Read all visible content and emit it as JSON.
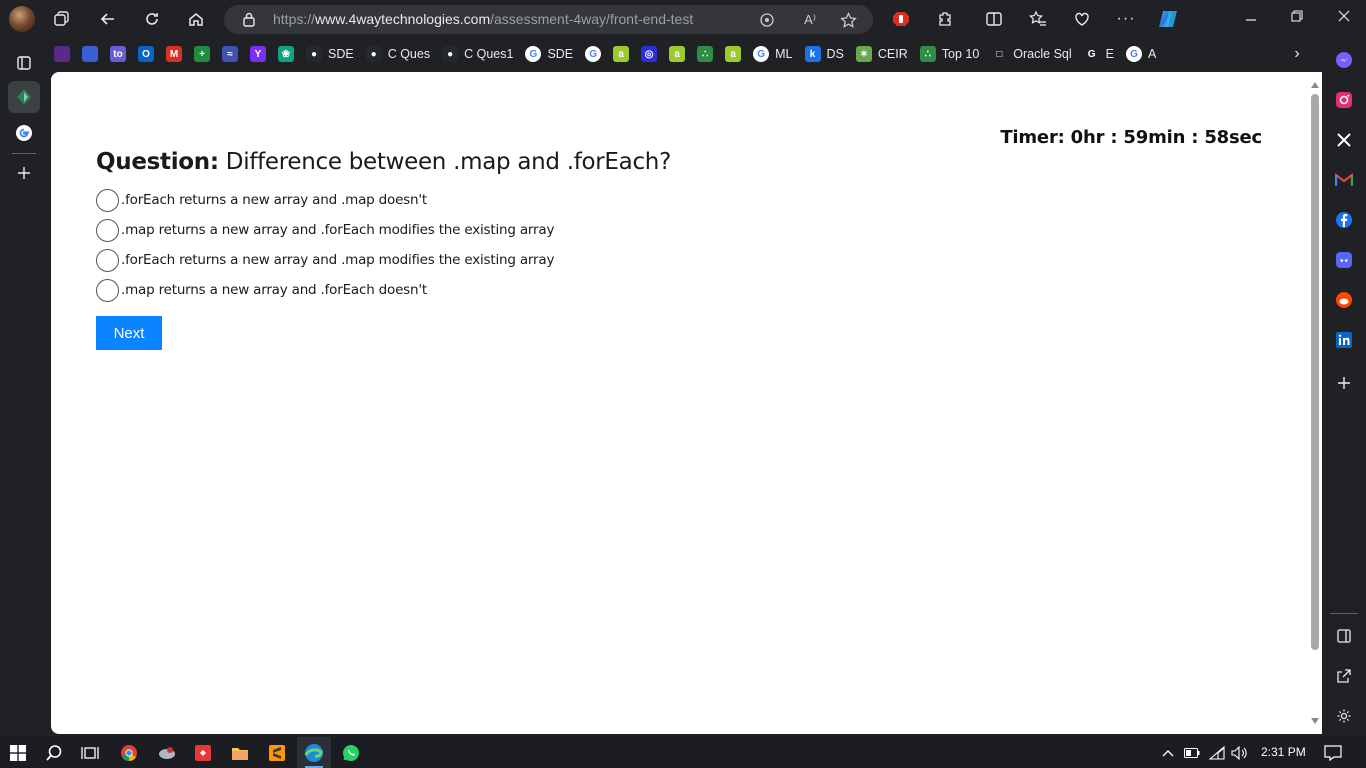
{
  "browser": {
    "url_prefix": "https://",
    "url_domain": "www.4waytechnologies.com",
    "url_path": "/assessment-4way/front-end-test",
    "read_aloud_label": "A⁾",
    "more_label": "···"
  },
  "bookmarks": [
    {
      "label": "",
      "icon": "purple-app-icon",
      "color": "#5b2a86"
    },
    {
      "label": "",
      "icon": "blue-circle-icon",
      "color": "#3a5ed8"
    },
    {
      "label": "",
      "icon": "to-icon",
      "color": "#6a5cd6",
      "glyph": "to"
    },
    {
      "label": "",
      "icon": "outlook-icon",
      "color": "#0a64c8",
      "glyph": "O"
    },
    {
      "label": "",
      "icon": "gmail-icon",
      "color": "#d93025",
      "glyph": "M"
    },
    {
      "label": "",
      "icon": "green-plus-icon",
      "color": "#1e8e3e",
      "glyph": "+"
    },
    {
      "label": "",
      "icon": "blue-waves-icon",
      "color": "#3f51b5",
      "glyph": "≈"
    },
    {
      "label": "",
      "icon": "purple-y-icon",
      "color": "#7b2ff7",
      "glyph": "Y"
    },
    {
      "label": "",
      "icon": "chatgpt-icon",
      "color": "#10a37f",
      "glyph": "❀"
    },
    {
      "label": "SDE",
      "icon": "github-icon",
      "color": "#24292e",
      "glyph": "●"
    },
    {
      "label": "C Ques",
      "icon": "github-icon",
      "color": "#24292e",
      "glyph": "●"
    },
    {
      "label": "C Ques1",
      "icon": "github-icon",
      "color": "#24292e",
      "glyph": "●"
    },
    {
      "label": "SDE",
      "icon": "google-icon",
      "color": "#ffffff",
      "glyph": "G"
    },
    {
      "label": "",
      "icon": "google-icon",
      "color": "#ffffff",
      "glyph": "G"
    },
    {
      "label": "",
      "icon": "yellow-a-icon",
      "color": "#9ccc2c",
      "glyph": "a"
    },
    {
      "label": "",
      "icon": "blue-ring-icon",
      "color": "#2b2fd6",
      "glyph": "◎"
    },
    {
      "label": "",
      "icon": "yellow-a-icon",
      "color": "#9ccc2c",
      "glyph": "a"
    },
    {
      "label": "",
      "icon": "gfg-icon",
      "color": "#2f8d46",
      "glyph": "∴"
    },
    {
      "label": "",
      "icon": "yellow-a-icon",
      "color": "#9ccc2c",
      "glyph": "a"
    },
    {
      "label": "ML",
      "icon": "google-icon",
      "color": "#ffffff",
      "glyph": "G"
    },
    {
      "label": "DS",
      "icon": "k-icon",
      "color": "#1a73e8",
      "glyph": "k"
    },
    {
      "label": "CEIR",
      "icon": "ceir-icon",
      "color": "#6aa84f",
      "glyph": "✶"
    },
    {
      "label": "Top 10",
      "icon": "gfg-icon",
      "color": "#2f8d46",
      "glyph": "∴"
    },
    {
      "label": "Oracle Sql",
      "icon": "page-icon",
      "color": "#202124",
      "glyph": "□"
    },
    {
      "label": "E",
      "icon": "google-g-icon",
      "color": "#202124",
      "glyph": "G"
    },
    {
      "label": "A",
      "icon": "google-icon",
      "color": "#ffffff",
      "glyph": "G"
    }
  ],
  "page": {
    "timer": "Timer: 0hr : 59min : 58sec",
    "question_label": "Question:",
    "question_text": "Difference between .map and .forEach?",
    "options": [
      ".forEach returns a new array and .map doesn't",
      ".map returns a new array and .forEach modifies the existing array",
      ".forEach returns a new array and .map modifies the existing array",
      ".map returns a new array and .forEach doesn't"
    ],
    "next_label": "Next"
  },
  "taskbar": {
    "time": "2:31 PM"
  },
  "colors": {
    "accent": "#0a84ff",
    "browser_bg": "#202124",
    "address_bar": "#35363a"
  }
}
